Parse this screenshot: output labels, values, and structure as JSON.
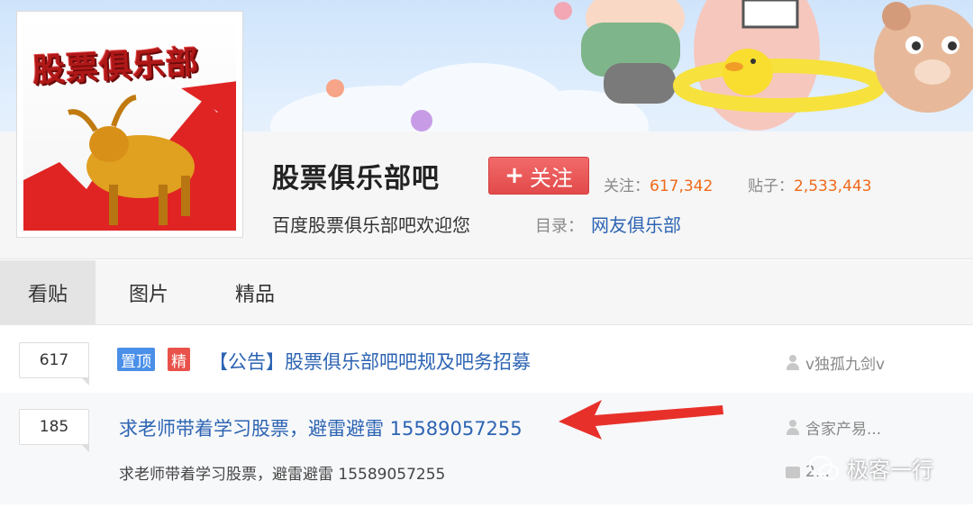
{
  "forum": {
    "name": "股票俱乐部吧",
    "logo_text": "股票俱乐部",
    "follow_label": "关注",
    "slogan": "百度股票俱乐部吧欢迎您",
    "stats": {
      "followers_label": "关注：",
      "followers_value": "617,342",
      "posts_label": "贴子：",
      "posts_value": "2,533,443"
    },
    "directory_label": "目录：",
    "directory_value": "网友俱乐部"
  },
  "tabs": [
    {
      "label": "看贴",
      "active": true
    },
    {
      "label": "图片",
      "active": false
    },
    {
      "label": "精品",
      "active": false
    }
  ],
  "threads": [
    {
      "reply_count": "617",
      "badges": [
        "置顶",
        "精"
      ],
      "title": "【公告】股票俱乐部吧吧规及吧务招募",
      "author": "v独孤九剑v"
    },
    {
      "reply_count": "185",
      "title": "求老师带着学习股票，避雷避雷 15589057255",
      "abstract": "求老师带着学习股票，避雷避雷 15589057255",
      "author": "含家产易...",
      "last_reply": "2..."
    }
  ],
  "watermark": "极客一行",
  "colors": {
    "link": "#2d64b3",
    "follow_button": "#e24a4a",
    "stat_number": "#f06a1a",
    "badge_top": "#4a8fe8",
    "badge_good": "#e8524a",
    "arrow": "#e8302a"
  },
  "icons": [
    "person-icon",
    "comment-icon",
    "wechat-icon",
    "bull-logo-icon",
    "arrow-annotation-icon"
  ]
}
